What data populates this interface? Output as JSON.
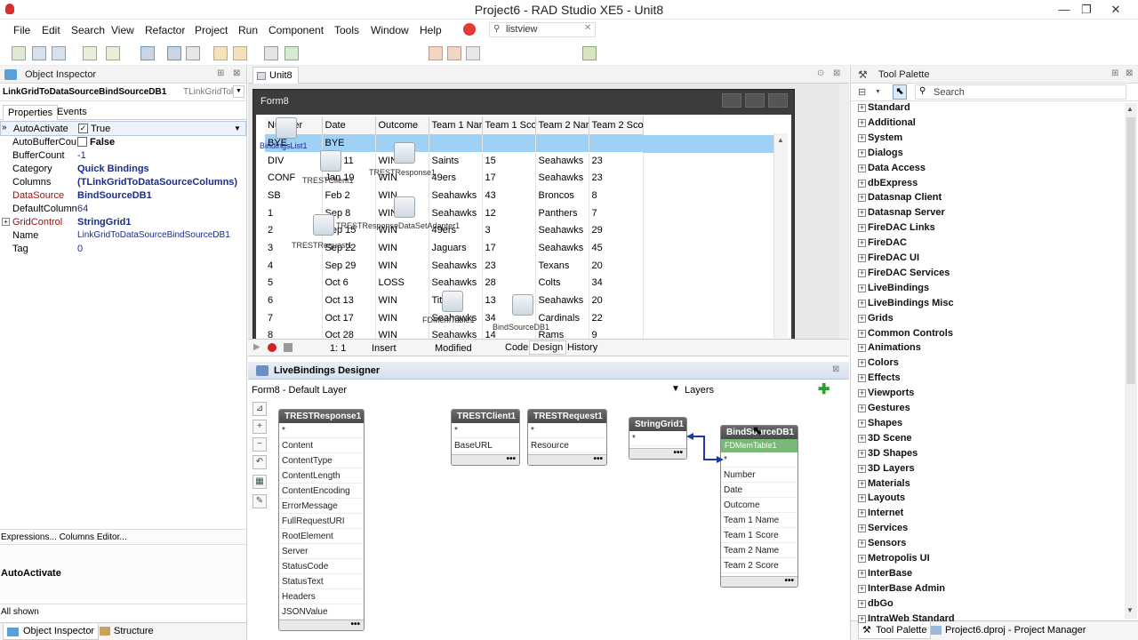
{
  "window": {
    "title": "Project6 - RAD Studio XE5 - Unit8",
    "minimize": "—",
    "maximize": "❐",
    "close": "✕"
  },
  "menu": [
    "File",
    "Edit",
    "Search",
    "View",
    "Refactor",
    "Project",
    "Run",
    "Component",
    "Tools",
    "Window",
    "Help"
  ],
  "search": {
    "value": "listview"
  },
  "object_inspector": {
    "title": "Object Inspector",
    "selected": "LinkGridToDataSourceBindSourceDB1",
    "selected_type": "TLinkGridTol",
    "tabs": [
      "Properties",
      "Events"
    ],
    "properties": [
      {
        "name": "AutoActivate",
        "value": "True",
        "checkbox": true
      },
      {
        "name": "AutoBufferCour",
        "value": "False",
        "checkbox": true
      },
      {
        "name": "BufferCount",
        "value": "-1"
      },
      {
        "name": "Category",
        "value": "Quick Bindings"
      },
      {
        "name": "Columns",
        "value": "(TLinkGridToDataSourceColumns)"
      },
      {
        "name": "DataSource",
        "value": "BindSourceDB1"
      },
      {
        "name": "DefaultColumnW",
        "value": "64"
      },
      {
        "name": "GridControl",
        "value": "StringGrid1"
      },
      {
        "name": "Name",
        "value": "LinkGridToDataSourceBindSourceDB1"
      },
      {
        "name": "Tag",
        "value": "0"
      }
    ],
    "links": "Expressions...  Columns Editor...",
    "desc_title": "AutoActivate",
    "status": "All shown",
    "bottom_tabs": [
      "Object Inspector",
      "Structure"
    ]
  },
  "editor": {
    "tab": "Unit8",
    "form_caption": "Form8",
    "grid": {
      "headers": [
        "Number",
        "Date",
        "Outcome",
        "Team 1 Nar",
        "Team 1 Sco",
        "Team 2 Nar",
        "Team 2 Sco"
      ],
      "rows": [
        [
          "BYE",
          "BYE",
          "",
          "",
          "",
          "",
          ""
        ],
        [
          "DIV",
          "Jan 11",
          "WIN",
          "Saints",
          "15",
          "Seahawks",
          "23"
        ],
        [
          "CONF",
          "Jan 19",
          "WIN",
          "49ers",
          "17",
          "Seahawks",
          "23"
        ],
        [
          "SB",
          "Feb 2",
          "WIN",
          "Seahawks",
          "43",
          "Broncos",
          "8"
        ],
        [
          "1",
          "Sep 8",
          "WIN",
          "Seahawks",
          "12",
          "Panthers",
          "7"
        ],
        [
          "2",
          "Sep 15",
          "WIN",
          "49ers",
          "3",
          "Seahawks",
          "29"
        ],
        [
          "3",
          "Sep 22",
          "WIN",
          "Jaguars",
          "17",
          "Seahawks",
          "45"
        ],
        [
          "4",
          "Sep 29",
          "WIN",
          "Seahawks",
          "23",
          "Texans",
          "20"
        ],
        [
          "5",
          "Oct 6",
          "LOSS",
          "Seahawks",
          "28",
          "Colts",
          "34"
        ],
        [
          "6",
          "Oct 13",
          "WIN",
          "Titans",
          "13",
          "Seahawks",
          "20"
        ],
        [
          "7",
          "Oct 17",
          "WIN",
          "Seahawks",
          "34",
          "Cardinals",
          "22"
        ],
        [
          "8",
          "Oct 28",
          "WIN",
          "Seahawks",
          "14",
          "Rams",
          "9"
        ]
      ]
    },
    "nonvisual": [
      {
        "label": "BindingsList1"
      },
      {
        "label": "TRESTClient1"
      },
      {
        "label": "TRESTResponse1"
      },
      {
        "label": "TRESTResponseDataSetAdapter1"
      },
      {
        "label": "TRESTRequest1"
      },
      {
        "label": "FDMemTable1"
      },
      {
        "label": "BindSourceDB1"
      }
    ],
    "status": {
      "pos": "1:   1",
      "mode": "Insert",
      "modified": "Modified",
      "tabs": [
        "Code",
        "Design",
        "History"
      ]
    }
  },
  "livebindings": {
    "title": "LiveBindings Designer",
    "layer": "Form8  - Default Layer",
    "layers_label": "Layers",
    "boxes": [
      {
        "title": "TRESTResponse1",
        "rows": [
          "*",
          "Content",
          "ContentType",
          "ContentLength",
          "ContentEncoding",
          "ErrorMessage",
          "FullRequestURI",
          "RootElement",
          "Server",
          "StatusCode",
          "StatusText",
          "Headers",
          "JSONValue"
        ]
      },
      {
        "title": "TRESTClient1",
        "rows": [
          "*",
          "BaseURL"
        ]
      },
      {
        "title": "TRESTRequest1",
        "rows": [
          "*",
          "Resource"
        ]
      },
      {
        "title": "StringGrid1",
        "rows": [
          "*"
        ]
      },
      {
        "title": "BindSourceDB1",
        "subtitle": "FDMemTable1",
        "rows": [
          "*",
          "Number",
          "Date",
          "Outcome",
          "Team 1 Name",
          "Team 1 Score",
          "Team 2 Name",
          "Team 2 Score"
        ]
      }
    ],
    "more": "•••"
  },
  "tool_palette": {
    "title": "Tool Palette",
    "search_placeholder": "Search",
    "categories": [
      "Standard",
      "Additional",
      "System",
      "Dialogs",
      "Data Access",
      "dbExpress",
      "Datasnap Client",
      "Datasnap Server",
      "FireDAC Links",
      "FireDAC",
      "FireDAC UI",
      "FireDAC Services",
      "LiveBindings",
      "LiveBindings Misc",
      "Grids",
      "Common Controls",
      "Animations",
      "Colors",
      "Effects",
      "Viewports",
      "Gestures",
      "Shapes",
      "3D Scene",
      "3D Shapes",
      "3D Layers",
      "Materials",
      "Layouts",
      "Internet",
      "Services",
      "Sensors",
      "Metropolis UI",
      "InterBase",
      "InterBase Admin",
      "dbGo",
      "IntraWeb Standard"
    ],
    "bottom_tabs": [
      "Tool Palette",
      "Project6.dproj - Project Manager"
    ]
  }
}
